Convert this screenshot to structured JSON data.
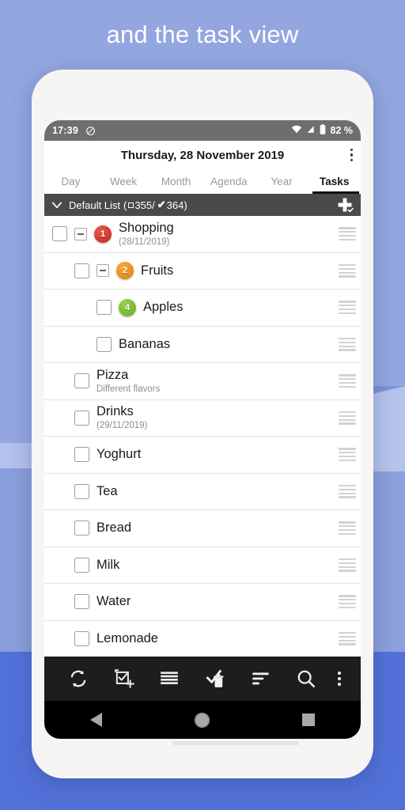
{
  "headline": "and the task view",
  "colors": {
    "bg_top": "#93a6e0",
    "bg_bottom": "#5271d8",
    "accent_red": "#d42d20",
    "accent_orange": "#ef8a1b",
    "accent_green": "#76bc2a",
    "toolbar": "#1d1d1d",
    "list_header": "#4a4a4a"
  },
  "statusbar": {
    "time": "17:39",
    "dnd_icon": "do-not-disturb-icon",
    "wifi_icon": "wifi-icon",
    "signal_icon": "signal-icon",
    "battery_icon": "battery-icon",
    "battery": "82 %"
  },
  "appbar": {
    "title": "Thursday, 28 November 2019",
    "overflow_icon": "overflow-menu-icon"
  },
  "tabs": [
    {
      "label": "Day",
      "active": false
    },
    {
      "label": "Week",
      "active": false
    },
    {
      "label": "Month",
      "active": false
    },
    {
      "label": "Agenda",
      "active": false
    },
    {
      "label": "Year",
      "active": false
    },
    {
      "label": "Tasks",
      "active": true
    }
  ],
  "list_header": {
    "chevron_icon": "chevron-down-icon",
    "name": "Default List",
    "open_prefix": "(",
    "open_count": "355",
    "separator": " / ",
    "check_glyph": "✔",
    "done_count": "364",
    "suffix": ")",
    "add_icon": "add-list-icon"
  },
  "tasks": [
    {
      "title": "Shopping",
      "subtitle": "(28/11/2019)",
      "indent": 0,
      "expand": true,
      "badge": "1",
      "badge_color": "#d42d20"
    },
    {
      "title": "Fruits",
      "subtitle": "",
      "indent": 1,
      "expand": true,
      "badge": "2",
      "badge_color": "#ef8a1b"
    },
    {
      "title": "Apples",
      "subtitle": "",
      "indent": 2,
      "expand": false,
      "badge": "4",
      "badge_color": "#76bc2a"
    },
    {
      "title": "Bananas",
      "subtitle": "",
      "indent": 2,
      "expand": false,
      "badge": "",
      "badge_color": ""
    },
    {
      "title": "Pizza",
      "subtitle": "Different flavors",
      "indent": 1,
      "expand": false,
      "badge": "",
      "badge_color": ""
    },
    {
      "title": "Drinks",
      "subtitle": "(29/11/2019)",
      "indent": 1,
      "expand": false,
      "badge": "",
      "badge_color": ""
    },
    {
      "title": "Yoghurt",
      "subtitle": "",
      "indent": 1,
      "expand": false,
      "badge": "",
      "badge_color": ""
    },
    {
      "title": "Tea",
      "subtitle": "",
      "indent": 1,
      "expand": false,
      "badge": "",
      "badge_color": ""
    },
    {
      "title": "Bread",
      "subtitle": "",
      "indent": 1,
      "expand": false,
      "badge": "",
      "badge_color": ""
    },
    {
      "title": "Milk",
      "subtitle": "",
      "indent": 1,
      "expand": false,
      "badge": "",
      "badge_color": ""
    },
    {
      "title": "Water",
      "subtitle": "",
      "indent": 1,
      "expand": false,
      "badge": "",
      "badge_color": ""
    },
    {
      "title": "Lemonade",
      "subtitle": "",
      "indent": 1,
      "expand": false,
      "badge": "",
      "badge_color": ""
    }
  ],
  "toolbar": [
    {
      "icon": "sync-icon"
    },
    {
      "icon": "add-task-icon"
    },
    {
      "icon": "list-view-icon"
    },
    {
      "icon": "delete-completed-icon"
    },
    {
      "icon": "sort-icon"
    },
    {
      "icon": "search-icon"
    },
    {
      "icon": "overflow-menu-icon"
    }
  ],
  "navbar": {
    "back_icon": "nav-back-icon",
    "home_icon": "nav-home-icon",
    "recents_icon": "nav-recents-icon"
  }
}
